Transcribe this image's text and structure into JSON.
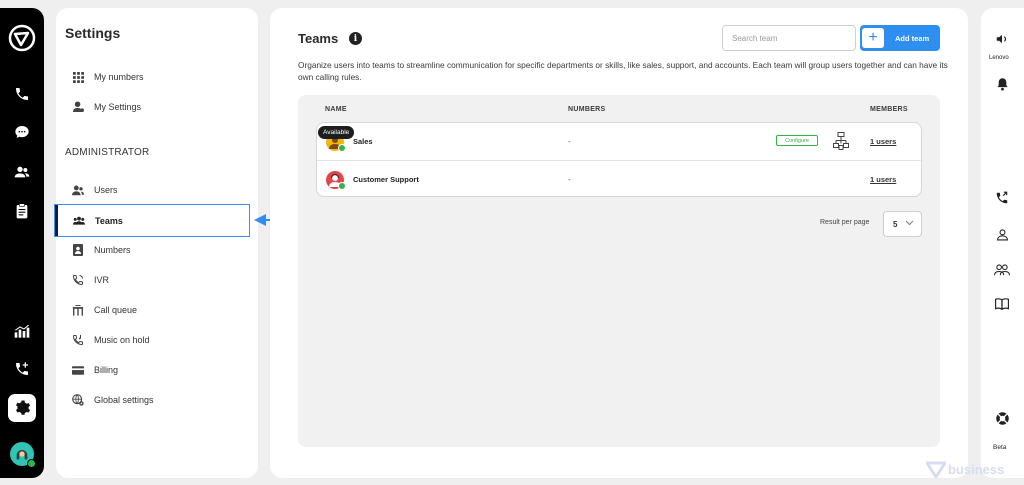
{
  "settings": {
    "title": "Settings",
    "personal_items": [
      {
        "label": "My numbers",
        "icon": "grid-icon"
      },
      {
        "label": "My Settings",
        "icon": "user-gear-icon"
      }
    ],
    "admin_heading": "ADMINISTRATOR",
    "admin_items": [
      {
        "label": "Users",
        "icon": "users-icon"
      },
      {
        "label": "Teams",
        "icon": "team-icon",
        "active": true
      },
      {
        "label": "Numbers",
        "icon": "contact-card-icon"
      },
      {
        "label": "IVR",
        "icon": "ivr-icon"
      },
      {
        "label": "Call queue",
        "icon": "call-queue-icon"
      },
      {
        "label": "Music on hold",
        "icon": "music-phone-icon"
      },
      {
        "label": "Billing",
        "icon": "credit-card-icon"
      },
      {
        "label": "Global settings",
        "icon": "globe-gear-icon"
      }
    ]
  },
  "main": {
    "title": "Teams",
    "info_glyph": "i",
    "search_placeholder": "Search team",
    "add_button_label": "Add team",
    "description": "Organize users into teams to streamline communication for specific departments or skills, like sales, support, and accounts. Each team will group users together and can have its own calling rules.",
    "columns": {
      "name": "NAME",
      "numbers": "NUMBERS",
      "members": "MEMBERS"
    },
    "teams": [
      {
        "name": "Sales",
        "numbers": "-",
        "members": "1 users",
        "avatar_color": "#f2b705",
        "configure_label": "Configure",
        "tooltip": "Available"
      },
      {
        "name": "Customer Support",
        "numbers": "-",
        "members": "1 users",
        "avatar_color": "#e8434a"
      }
    ],
    "result_per_page_label": "Result per page",
    "result_per_page_value": "5"
  },
  "right_rail": {
    "device_label": "Lenovo",
    "beta_label": "Beta"
  },
  "watermark": "business",
  "colors": {
    "accent": "#2f8ff0",
    "success": "#36b24a",
    "rail": "#000000"
  }
}
